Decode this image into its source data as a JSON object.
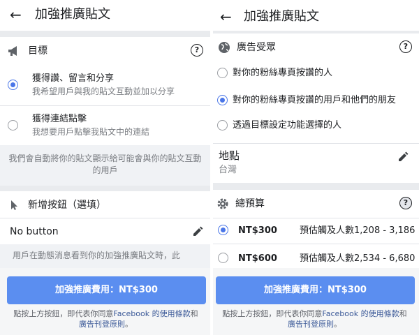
{
  "left": {
    "title": "加強推廣貼文",
    "goal": {
      "label": "目標",
      "options": [
        {
          "title": "獲得讚、留言和分享",
          "desc": "我希望用戶與我的貼文互動並加以分享",
          "selected": true
        },
        {
          "title": "獲得連結點擊",
          "desc": "我想要用戶點擊我貼文中的連結",
          "selected": false
        }
      ],
      "note": "我們會自動將你的貼文顯示給可能會與你的貼文互動的用戶"
    },
    "button_section": {
      "label": "新增按鈕（選填）",
      "value": "No button",
      "cut_text": "用戶在動態消息看到你的加強推廣貼文時，此"
    },
    "cta": "加強推廣費用：NT$300",
    "legal": {
      "prefix": "點按上方按鈕，即代表你同意",
      "facebook": "Facebook",
      "terms": " 的使用條款",
      "and": "和",
      "policy": "廣告刊登原則",
      "suffix": "。"
    }
  },
  "right": {
    "title": "加強推廣貼文",
    "audience": {
      "label": "廣告受眾",
      "options": [
        {
          "title": "對你的粉絲專頁按讚的人",
          "selected": false
        },
        {
          "title": "對你的粉絲專頁按讚的用戶和他們的朋友",
          "selected": true
        },
        {
          "title": "透過目標設定功能選擇的人",
          "selected": false
        }
      ]
    },
    "location": {
      "label": "地點",
      "value": "台灣"
    },
    "budget": {
      "label": "總預算",
      "options": [
        {
          "amount": "NT$300",
          "reach": "預估觸及人數1,208 - 3,186",
          "selected": true
        },
        {
          "amount": "NT$600",
          "reach": "預估觸及人數2,534 - 6,680",
          "selected": false
        }
      ]
    },
    "cta": "加強推廣費用：NT$300",
    "legal": {
      "prefix": "點按上方按鈕，即代表你同意",
      "facebook": "Facebook",
      "terms": " 的使用條款",
      "and": "和",
      "policy": "廣告刊登原則",
      "suffix": "。"
    }
  },
  "icons": {
    "back": "←",
    "help": "?"
  },
  "colors": {
    "accent": "#4a76e8",
    "cta": "#5b8ef0",
    "link": "#3b5998"
  }
}
